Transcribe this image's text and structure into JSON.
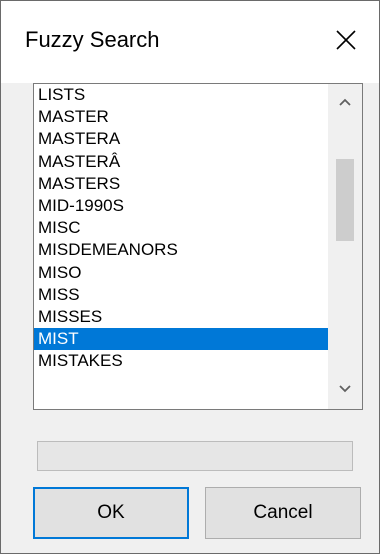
{
  "window": {
    "title": "Fuzzy Search"
  },
  "list": {
    "items": [
      {
        "label": "LISTS",
        "selected": false
      },
      {
        "label": "MASTER",
        "selected": false
      },
      {
        "label": "MASTERA",
        "selected": false
      },
      {
        "label": "MASTERÂ",
        "selected": false
      },
      {
        "label": "MASTERS",
        "selected": false
      },
      {
        "label": "MID-1990S",
        "selected": false
      },
      {
        "label": "MISC",
        "selected": false
      },
      {
        "label": "MISDEMEANORS",
        "selected": false
      },
      {
        "label": "MISO",
        "selected": false
      },
      {
        "label": "MISS",
        "selected": false
      },
      {
        "label": "MISSES",
        "selected": false
      },
      {
        "label": "MIST",
        "selected": true
      },
      {
        "label": "MISTAKES",
        "selected": false
      }
    ],
    "selection_color": "#0078d7"
  },
  "buttons": {
    "ok_label": "OK",
    "cancel_label": "Cancel"
  },
  "icons": {
    "close": "close-icon",
    "scroll_up": "chevron-up-icon",
    "scroll_down": "chevron-down-icon"
  }
}
